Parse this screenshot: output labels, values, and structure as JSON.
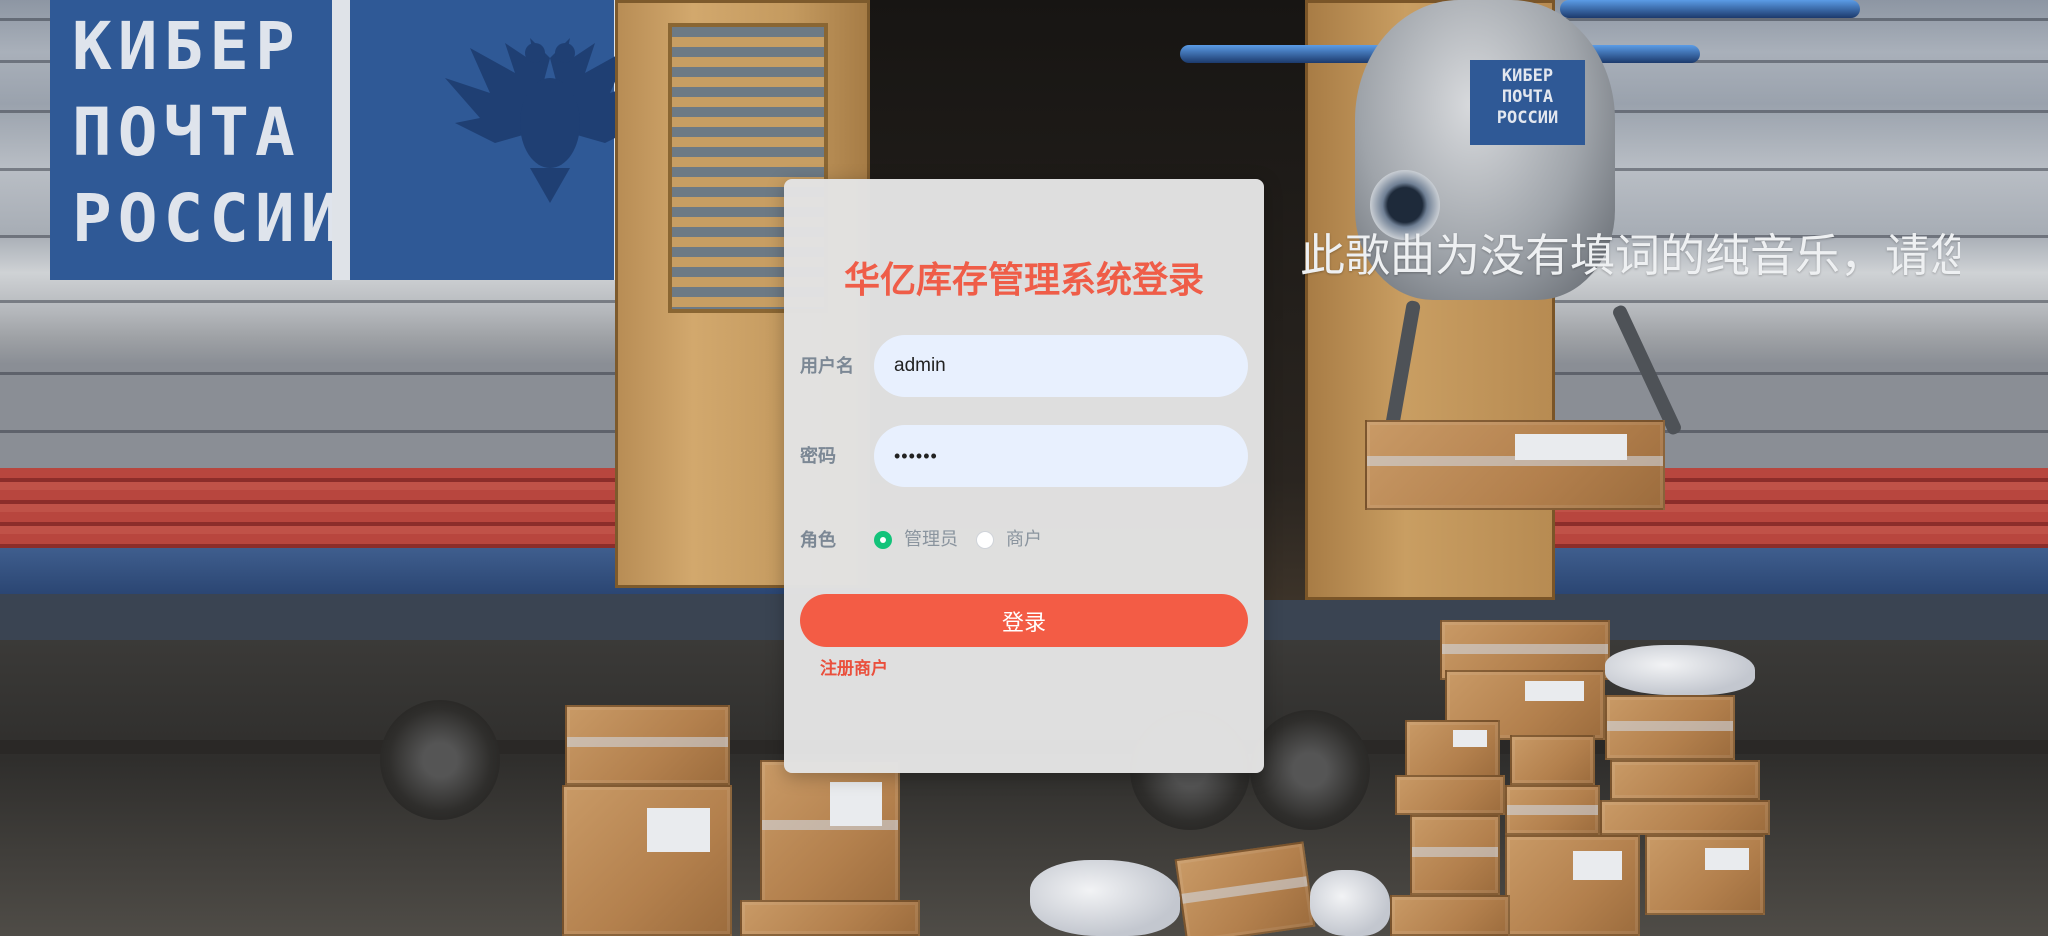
{
  "background": {
    "panel_text": "КИБЕР\nПОЧТА\nРОССИИ",
    "robot_badge_text": "КИБЕР\nПОЧТА\nРОССИИ",
    "lyric_text": "此歌曲为没有填词的纯音乐，请您"
  },
  "login": {
    "title": "华亿库存管理系统登录",
    "username_label": "用户名",
    "username_value": "admin",
    "password_label": "密码",
    "password_value": "••••••",
    "role_label": "角色",
    "roles": [
      {
        "label": "管理员",
        "checked": true
      },
      {
        "label": "商户",
        "checked": false
      }
    ],
    "submit_label": "登录",
    "register_label": "注册商户"
  },
  "colors": {
    "accent": "#f35c45",
    "title": "#ef5d48",
    "radio_checked": "#13c37a",
    "input_bg": "#e8f0fe",
    "card_bg": "#e2e2e2"
  }
}
